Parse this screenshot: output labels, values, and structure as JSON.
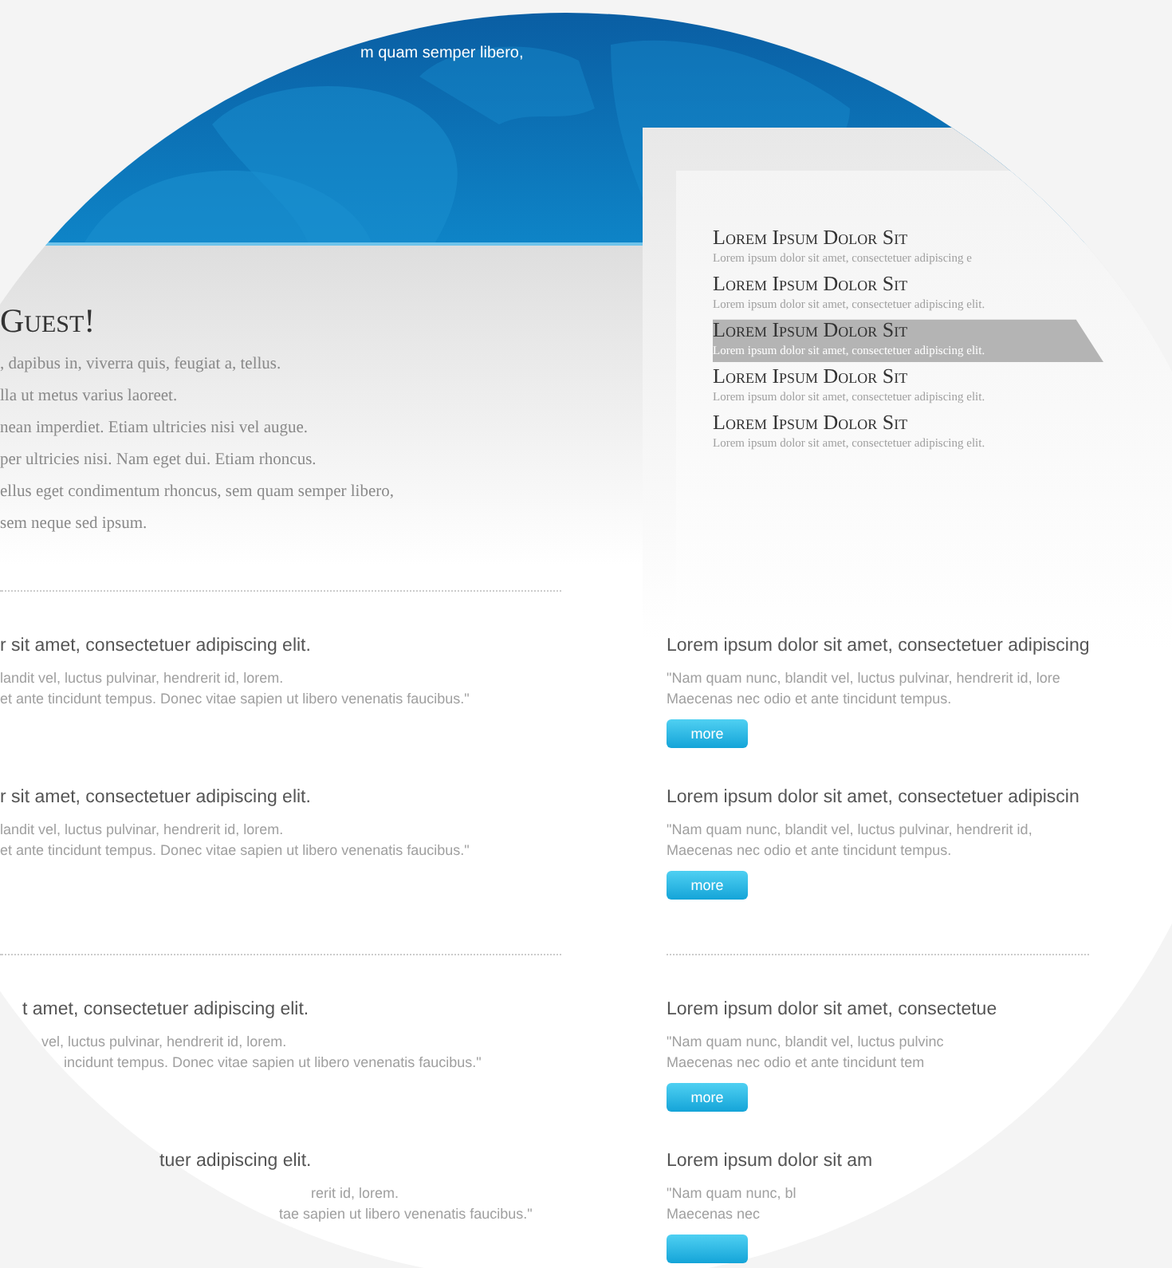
{
  "banner": {
    "text": "m quam semper libero,"
  },
  "welcome": {
    "heading": "Guest!",
    "lines": [
      ", dapibus in, viverra quis, feugiat a, tellus.",
      "lla ut metus varius laoreet.",
      "nean imperdiet. Etiam ultricies nisi vel augue.",
      "per ultricies nisi. Nam eget dui. Etiam rhoncus.",
      "ellus eget condimentum rhoncus, sem quam semper libero,",
      "sem neque sed ipsum."
    ]
  },
  "side_list": [
    {
      "title": "Lorem Ipsum Dolor Sit",
      "text": "Lorem ipsum dolor sit amet, consectetuer adipiscing e",
      "selected": false
    },
    {
      "title": "Lorem Ipsum Dolor Sit",
      "text": "Lorem ipsum dolor sit amet, consectetuer adipiscing elit.",
      "selected": false
    },
    {
      "title": "Lorem Ipsum Dolor Sit",
      "text": "Lorem ipsum dolor sit amet, consectetuer adipiscing elit.",
      "selected": true
    },
    {
      "title": "Lorem Ipsum Dolor Sit",
      "text": "Lorem ipsum dolor sit amet, consectetuer adipiscing elit.",
      "selected": false
    },
    {
      "title": "Lorem Ipsum Dolor Sit",
      "text": "Lorem ipsum dolor sit amet, consectetuer adipiscing elit.",
      "selected": false
    }
  ],
  "left_articles": [
    {
      "title": "r sit amet, consectetuer adipiscing elit.",
      "lines": [
        "landit vel, luctus pulvinar, hendrerit id, lorem.",
        "et ante tincidunt tempus. Donec vitae sapien ut libero venenatis faucibus.\""
      ]
    },
    {
      "title": "r sit amet, consectetuer adipiscing elit.",
      "lines": [
        "landit vel, luctus pulvinar, hendrerit id, lorem.",
        "et ante tincidunt tempus. Donec vitae sapien ut libero venenatis faucibus.\""
      ]
    },
    {
      "title": "t amet, consectetuer adipiscing elit.",
      "lines": [
        "vel, luctus pulvinar, hendrerit id, lorem.",
        "incidunt tempus. Donec vitae sapien ut libero venenatis faucibus.\""
      ]
    },
    {
      "title": "tuer adipiscing elit.",
      "lines": [
        "rerit id, lorem.",
        "tae sapien ut libero venenatis faucibus.\""
      ]
    }
  ],
  "right_articles": [
    {
      "title": "Lorem ipsum dolor sit amet, consectetuer adipiscing",
      "lines": [
        "\"Nam quam nunc, blandit vel, luctus pulvinar, hendrerit id, lore",
        "Maecenas nec odio et ante tincidunt tempus."
      ],
      "has_button": true,
      "button_label": "more"
    },
    {
      "title": "Lorem ipsum dolor sit amet, consectetuer adipiscin",
      "lines": [
        "\"Nam quam nunc, blandit vel, luctus pulvinar, hendrerit id,",
        "Maecenas nec odio et ante tincidunt tempus."
      ],
      "has_button": true,
      "button_label": "more"
    },
    {
      "title": "Lorem ipsum dolor sit amet, consectetue",
      "lines": [
        "\"Nam quam nunc, blandit vel, luctus pulvinc",
        "Maecenas nec odio et ante tincidunt tem"
      ],
      "has_button": true,
      "button_label": "more"
    },
    {
      "title": "Lorem ipsum dolor sit am",
      "lines": [
        "\"Nam quam nunc, bl",
        "Maecenas nec"
      ],
      "has_button": true
    }
  ]
}
